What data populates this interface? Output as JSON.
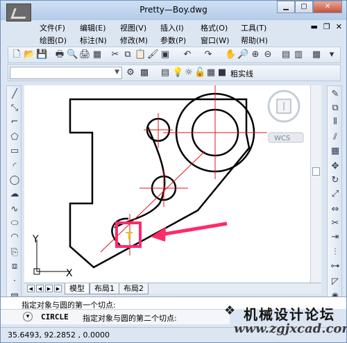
{
  "window": {
    "title": "Pretty—Boy.dwg"
  },
  "menu_row1": [
    "文件(F)",
    "编辑(E)",
    "视图(V)",
    "插入(I)",
    "格式(O)",
    "工具(T)"
  ],
  "menu_row2": [
    "绘图(D)",
    "标注(N)",
    "修改(M)",
    "参数(P)",
    "窗口(W)",
    "帮助(H)"
  ],
  "layer": {
    "linetype_label": "粗实线"
  },
  "viewcube": {
    "wcs": "WCS"
  },
  "ucs": {
    "x": "X",
    "y": "Y"
  },
  "tabs": [
    "模型",
    "布局1",
    "布局2"
  ],
  "command": {
    "line1": "指定对象与圆的第一个切点:",
    "name": "CIRCLE",
    "line2": "指定对象与圆的第二个切点:"
  },
  "status": {
    "coords": "35.6493,   92.2852  , 0.0000"
  },
  "watermark": {
    "text": "机械设计论坛",
    "url": "www.zgjxcad.com"
  },
  "colors": {
    "highlight": "#ff2a6a",
    "centerline": "#e0131b"
  }
}
